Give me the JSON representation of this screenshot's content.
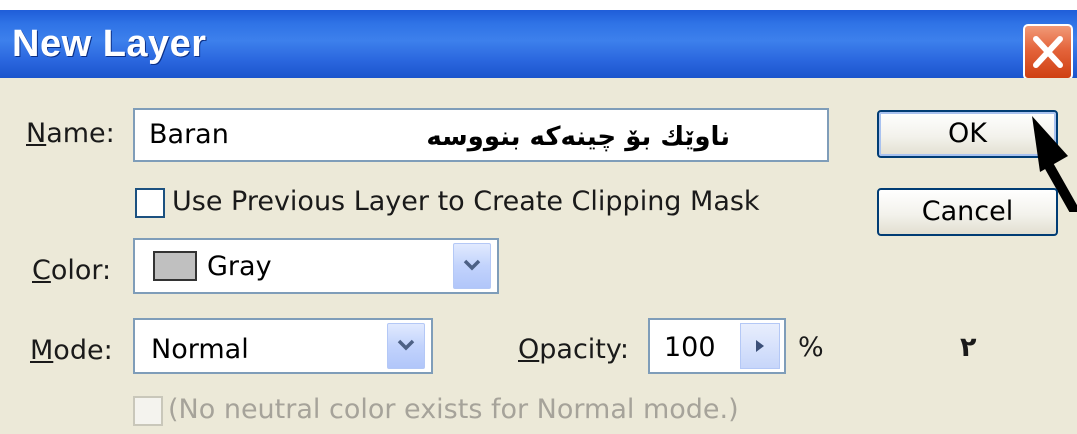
{
  "dialog": {
    "title": "New Layer",
    "close_icon": "close-x-icon"
  },
  "name_row": {
    "label_underlined": "N",
    "label_rest": "ame:",
    "value": "Baran",
    "annotation": "ناوێك بۆ چینەكە بنووسە"
  },
  "clipping_mask": {
    "label": "Use Previous Layer to Create Clipping Mask",
    "checked": false
  },
  "color_row": {
    "label_underlined": "C",
    "label_rest": "olor:",
    "value": "Gray",
    "swatch_color": "#c0c0c0"
  },
  "mode_row": {
    "label_underlined": "M",
    "label_rest": "ode:",
    "value": "Normal"
  },
  "opacity_row": {
    "label_underlined": "O",
    "label_rest": "pacity:",
    "value": "100",
    "unit": "%"
  },
  "neutral_color": {
    "label": "(No neutral color exists for Normal mode.)",
    "enabled": false
  },
  "buttons": {
    "ok": "OK",
    "cancel": "Cancel"
  },
  "annotation_number": "٢",
  "colors": {
    "titlebar": "#2f73e6",
    "dialog_bg": "#ece9d8",
    "close_button": "#e4643b",
    "button_border": "#003c74"
  }
}
